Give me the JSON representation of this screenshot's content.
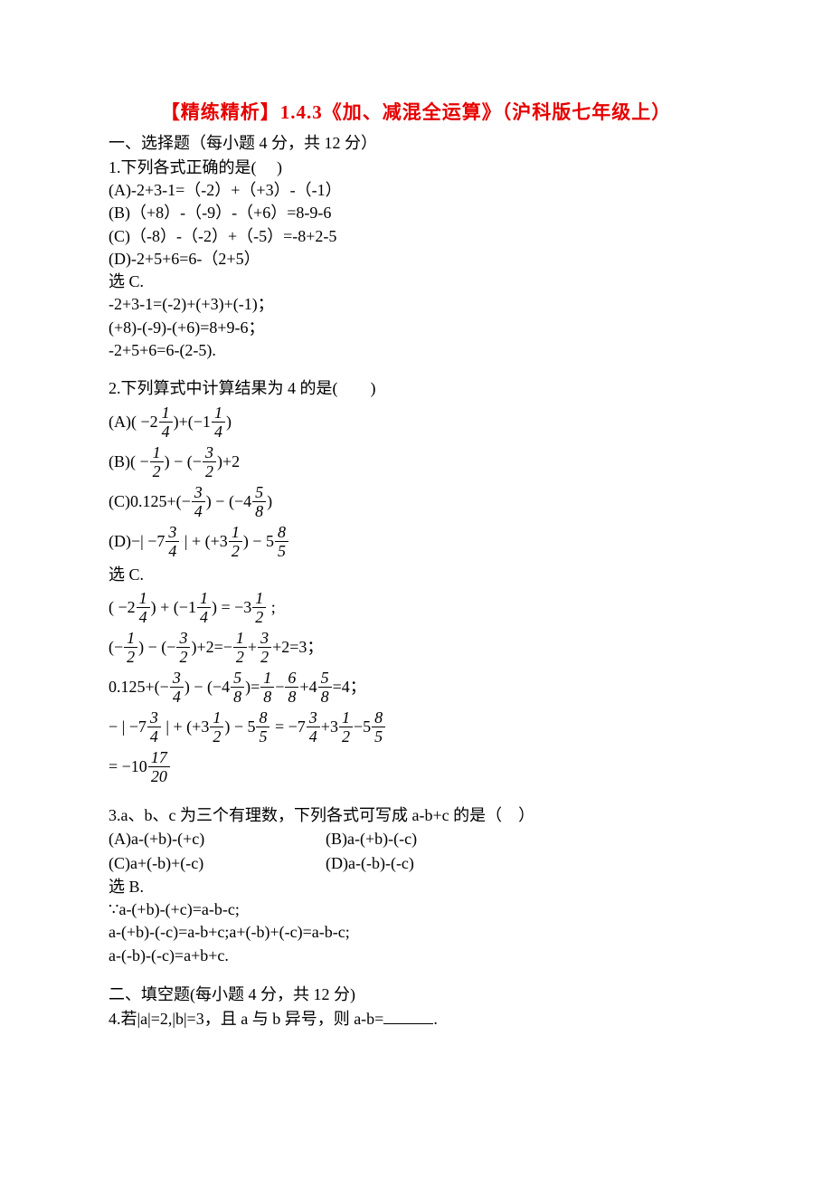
{
  "title": "【精练精析】1.4.3《加、减混全运算》（沪科版七年级上）",
  "section1": {
    "header": "一、选择题（每小题 4 分，共 12 分）",
    "q1": {
      "stem": "1.下列各式正确的是(　 )",
      "optA": "(A)-2+3-1=（-2）+（+3）-（-1）",
      "optB": "(B)（+8）-（-9）-（+6）=8-9-6",
      "optC": "(C)（-8）-（-2）+（-5）=-8+2-5",
      "optD": "(D)-2+5+6=6-（2+5）",
      "ans": "选 C.",
      "exp1": "-2+3-1=(-2)+(+3)+(-1)；",
      "exp2": "(+8)-(-9)-(+6)=8+9-6；",
      "exp3": "-2+5+6=6-(2-5)."
    },
    "q2": {
      "stem": "2.下列算式中计算结果为 4 的是(　　)",
      "ans": "选 C."
    },
    "q3": {
      "stem": "3.a、b、c 为三个有理数，下列各式可写成 a-b+c 的是（　）",
      "optA": "(A)a-(+b)-(+c)",
      "optB": "(B)a-(+b)-(-c)",
      "optC": "(C)a+(-b)+(-c)",
      "optD": "(D)a-(-b)-(-c)",
      "ans": "选 B.",
      "exp1": "∵a-(+b)-(+c)=a-b-c;",
      "exp2": "a-(+b)-(-c)=a-b+c;a+(-b)+(-c)=a-b-c;",
      "exp3": "a-(-b)-(-c)=a+b+c."
    }
  },
  "section2": {
    "header": "二、填空题(每小题 4 分，共 12 分)",
    "q4_pre": "4.若|a|=2,|b|=3，且 a 与 b 异号，则 a-b=",
    "q4_post": "."
  }
}
